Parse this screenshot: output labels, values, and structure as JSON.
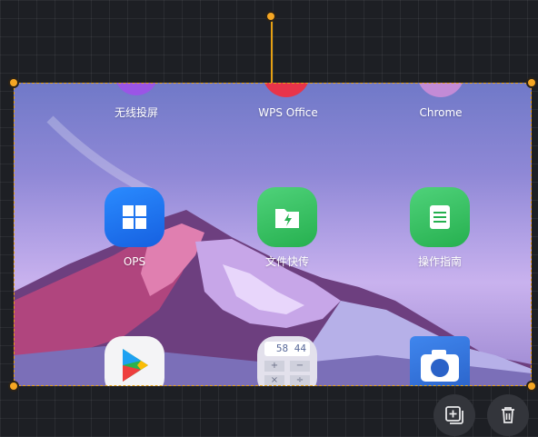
{
  "apps": {
    "row1": [
      "无线投屏",
      "WPS Office",
      "Chrome"
    ],
    "row2": [
      "OPS",
      "文件快传",
      "操作指南"
    ]
  },
  "calculator_display": "58 44",
  "calculator_keys": [
    "+",
    "−",
    "×",
    "÷"
  ],
  "colors": {
    "selection": "#e6a012",
    "grid_bg": "#1d1f24",
    "ops_icon": "#1e6ff0",
    "file_icon": "#2fbe5a",
    "guide_icon": "#2fbe5a",
    "camera_icon": "#2f6fd8"
  },
  "toolbar": {
    "add_icon": "add-box-icon",
    "delete_icon": "trash-icon"
  }
}
